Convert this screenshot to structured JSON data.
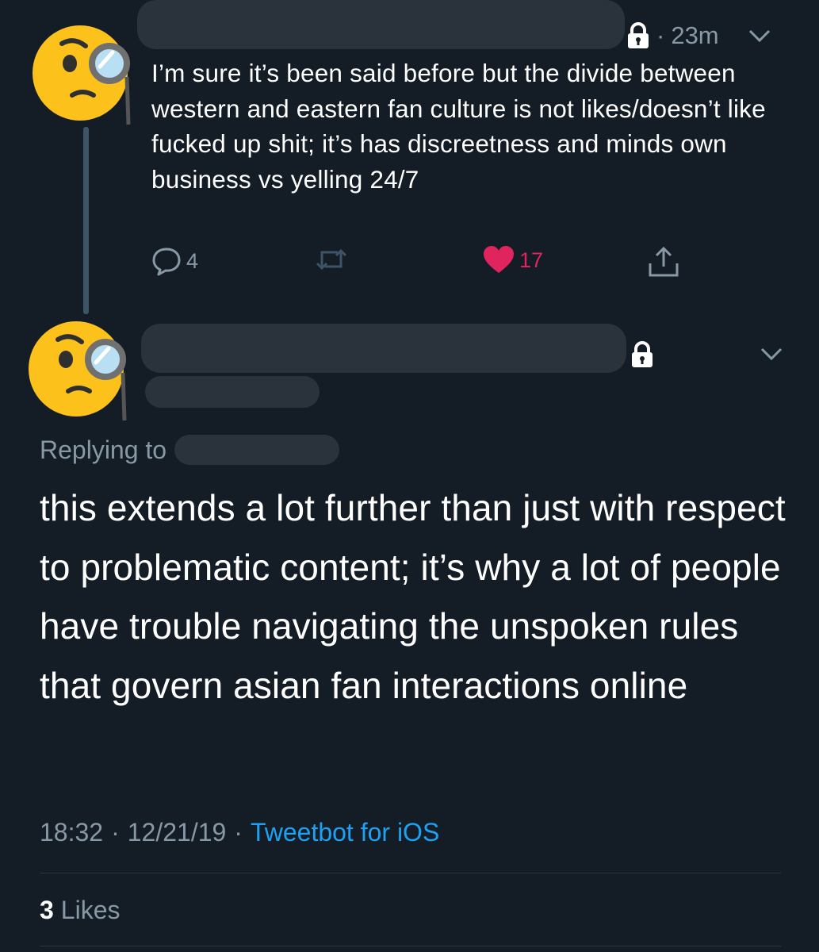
{
  "tweet1": {
    "time_sep": "·",
    "time": "23m",
    "text": "I’m sure it’s been said before but the divide between western and eastern fan culture is not likes/doesn’t like fucked up shit; it’s has discreetness and minds own business vs yelling 24/7",
    "reply_count": "4",
    "like_count": "17",
    "colors": {
      "like": "#e0245e",
      "muted": "#8899a6"
    }
  },
  "tweet2": {
    "replying_label": "Replying to",
    "text": "this extends a lot further than just with respect to problematic content; it’s why a lot of people have trouble navigating the unspoken rules that govern asian fan interactions online",
    "time": "18:32",
    "sep1": "·",
    "date": "12/21/19",
    "sep2": "·",
    "client": "Tweetbot for iOS",
    "likes_count": "3",
    "likes_label": "Likes"
  },
  "icons": [
    "monocle-face-avatar",
    "lock-icon",
    "chevron-down-icon",
    "reply-icon",
    "retweet-icon",
    "heart-icon",
    "share-icon"
  ],
  "colors": {
    "background": "#141d26",
    "link": "#1da1f2"
  }
}
